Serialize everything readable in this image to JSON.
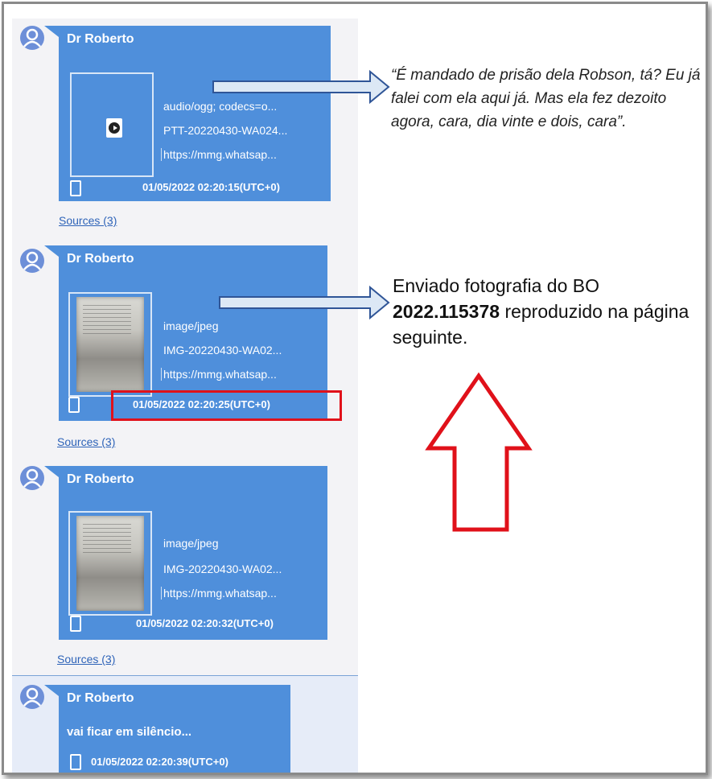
{
  "messages": [
    {
      "sender": "Dr Roberto",
      "type": "audio",
      "mime": "audio/ogg; codecs=o...",
      "filename": "PTT-20220430-WA024...",
      "url": "https://mmg.whatsap...",
      "timestamp": "01/05/2022 02:20:15(UTC+0)",
      "sources": "Sources (3)"
    },
    {
      "sender": "Dr Roberto",
      "type": "image",
      "mime": "image/jpeg",
      "filename": "IMG-20220430-WA02...",
      "url": "https://mmg.whatsap...",
      "timestamp": "01/05/2022 02:20:25(UTC+0)",
      "sources": "Sources (3)",
      "highlighted": true
    },
    {
      "sender": "Dr Roberto",
      "type": "image",
      "mime": "image/jpeg",
      "filename": "IMG-20220430-WA02...",
      "url": "https://mmg.whatsap...",
      "timestamp": "01/05/2022 02:20:32(UTC+0)",
      "sources": "Sources (3)"
    },
    {
      "sender": "Dr Roberto",
      "type": "text",
      "text": "vai ficar em silêncio...",
      "timestamp": "01/05/2022 02:20:39(UTC+0)"
    }
  ],
  "annotations": {
    "quote": "“É mandado de prisão dela Robson, tá? Eu já falei com ela aqui já. Mas ela fez dezoito agora, cara, dia vinte e dois, cara”.",
    "note_prefix": "Enviado fotografia do BO",
    "note_bold": "2022.115378",
    "note_suffix": "reproduzido na página seguinte."
  },
  "colors": {
    "bubble": "#4f8fdb",
    "highlight": "#e0111a",
    "pointer_arrow_fill": "#dce8f5",
    "pointer_arrow_stroke": "#2f5597"
  },
  "icons": [
    "user-avatar-icon",
    "play-audio-icon",
    "mobile-device-icon",
    "red-up-arrow"
  ]
}
